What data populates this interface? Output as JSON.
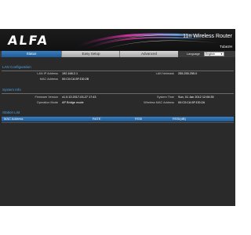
{
  "header": {
    "logo_text": "ALFA",
    "logo_sub": "",
    "router_title": "11n Wireless Router",
    "router_name": "Tube2H"
  },
  "tabs": [
    {
      "label": "Status",
      "active": true
    },
    {
      "label": "Easy Setup",
      "active": false
    },
    {
      "label": "Advanced",
      "active": false
    }
  ],
  "language": {
    "label": "Language",
    "selected": "English"
  },
  "lan": {
    "title": "LAN Configuration",
    "ip_label": "LAN IP Address",
    "ip_value": "192.168.2.1",
    "mac_label": "MAC Address",
    "mac_value": "00:C0:CA:5F:DD:2B",
    "netmask_label": "LAN Netmask",
    "netmask_value": "255.255.255.0"
  },
  "system": {
    "title": "System Info",
    "firmware_label": "Firmware Version",
    "firmware_value": "v1.0.13  2017-03-27 17:43",
    "mode_label": "Operation Mode",
    "mode_value": "AP Bridge mode",
    "time_label": "System Time",
    "time_value": "Sun, 01 Jan 2012 12:06:35",
    "wmac_label": "Wireless MAC Address",
    "wmac_value": "00:C0:CA:5F:DD:2A"
  },
  "station": {
    "title": "Station List",
    "columns": [
      "MAC Address",
      "RATE",
      "RSSI",
      "RSSI(dB)"
    ]
  },
  "colors": {
    "accent": "#1e5b98",
    "section_title": "#4aa3e8",
    "background": "#2a2a2a"
  }
}
